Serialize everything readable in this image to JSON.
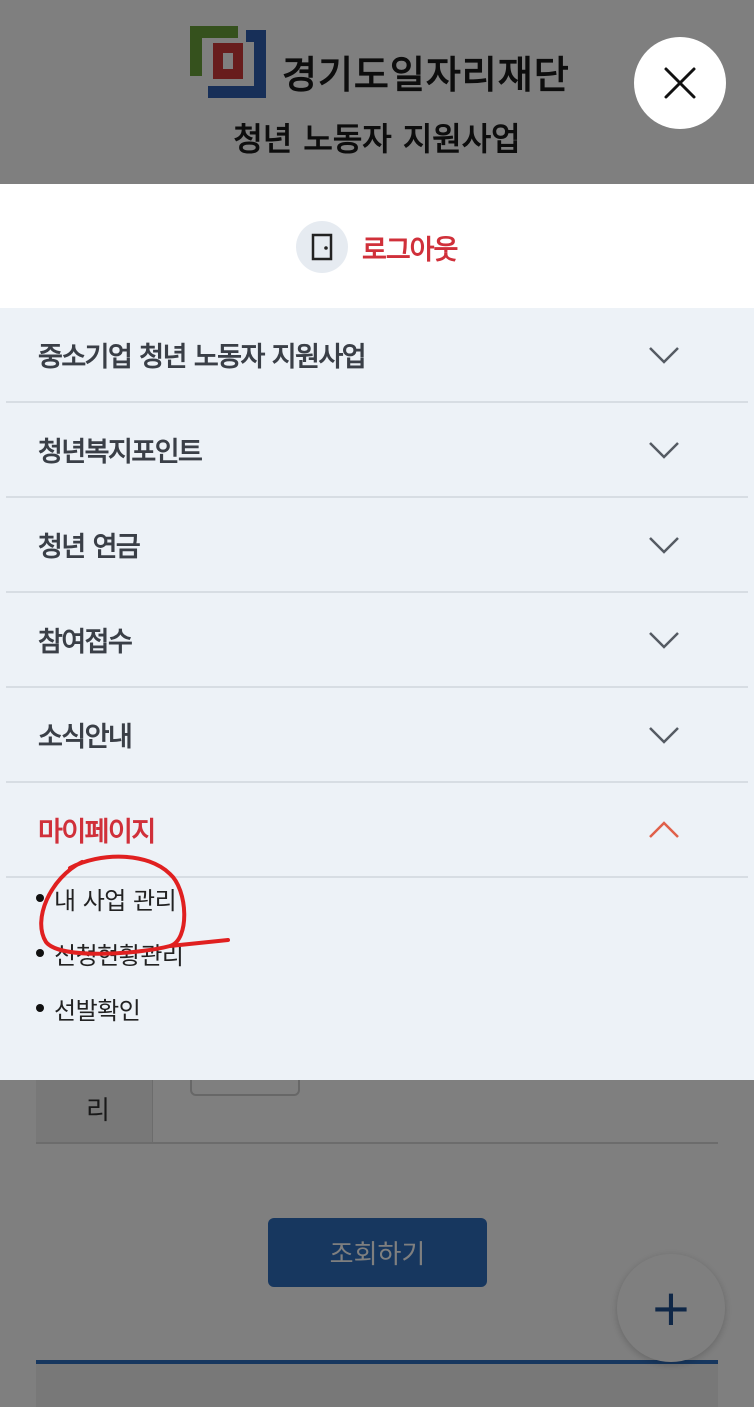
{
  "header": {
    "org_name": "경기도일자리재단",
    "program_name": "청년 노동자 지원사업",
    "logo_colors": [
      "#6aa23a",
      "#d03a3a",
      "#2e5fb0"
    ]
  },
  "close_icon": "close-icon",
  "logout": {
    "icon": "door-icon",
    "label": "로그아웃"
  },
  "menu": {
    "items": [
      {
        "label": "중소기업 청년 노동자 지원사업",
        "expanded": false
      },
      {
        "label": "청년복지포인트",
        "expanded": false
      },
      {
        "label": "청년 연금",
        "expanded": false
      },
      {
        "label": "참여접수",
        "expanded": false
      },
      {
        "label": "소식안내",
        "expanded": false
      },
      {
        "label": "마이페이지",
        "expanded": true
      }
    ],
    "submenu": [
      {
        "label": "내 사업 관리"
      },
      {
        "label": "신청현황관리"
      },
      {
        "label": "선발확인"
      }
    ]
  },
  "background": {
    "form_label_fragment": "리",
    "search_button": "조회하기",
    "fab_symbol": "+"
  },
  "colors": {
    "accent_red": "#d0303a",
    "primary_blue": "#2e6fbf",
    "menu_bg": "#edf2f7",
    "overlay": "rgba(0,0,0,0.5)"
  }
}
